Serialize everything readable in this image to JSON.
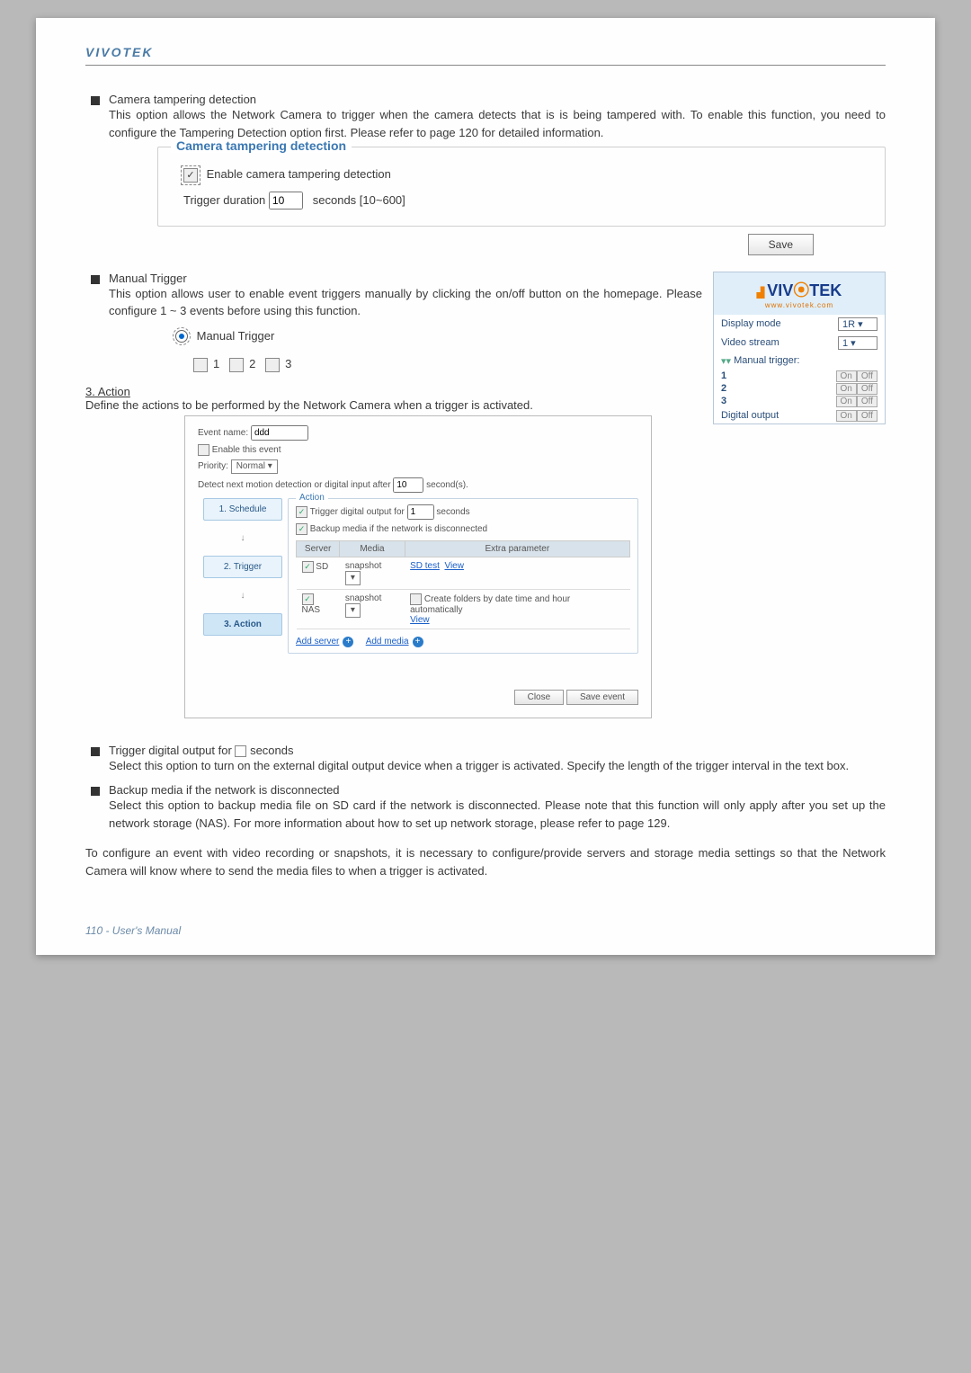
{
  "brand": "VIVOTEK",
  "sections": {
    "tampering": {
      "title": "Camera tampering detection",
      "body": "This option allows the Network Camera to trigger when the camera detects that is is being tampered with. To enable this function, you need to configure the Tampering Detection option first. Please refer to page 120 for detailed information.",
      "legend": "Camera tampering detection",
      "enable_label": "Enable camera tampering detection",
      "trigger_label": "Trigger duration",
      "trigger_value": "10",
      "trigger_units": "seconds [10~600]",
      "save_btn": "Save"
    },
    "manual": {
      "title": "Manual Trigger",
      "body": "This option allows user to enable event triggers manually by clicking the on/off button on the homepage. Please configure 1 ~ 3 events before using this function.",
      "radio_label": "Manual Trigger",
      "check_labels": [
        "1",
        "2",
        "3"
      ]
    },
    "panel": {
      "logo_sub": "www.vivotek.com",
      "display_mode_label": "Display mode",
      "display_mode_value": "1R",
      "video_stream_label": "Video stream",
      "video_stream_value": "1",
      "manual_trigger_label": "Manual trigger:",
      "rows": [
        {
          "n": "1",
          "on": "On",
          "off": "Off"
        },
        {
          "n": "2",
          "on": "On",
          "off": "Off"
        },
        {
          "n": "3",
          "on": "On",
          "off": "Off"
        }
      ],
      "digital_output_label": "Digital output",
      "digital_output_on": "On",
      "digital_output_off": "Off"
    },
    "action": {
      "heading": "3. Action",
      "body": "Define the actions to be performed by the Network Camera when a trigger is activated.",
      "event_name_label": "Event name:",
      "event_name_value": "ddd",
      "enable_event_label": "Enable this event",
      "priority_label": "Priority:",
      "priority_value": "Normal",
      "detect_label_a": "Detect next motion detection or digital input after",
      "detect_value": "10",
      "detect_label_b": "second(s).",
      "steps": [
        "1. Schedule",
        "2. Trigger",
        "3. Action"
      ],
      "legend": "Action",
      "trigger_do_label": "Trigger digital output for",
      "trigger_do_value": "1",
      "trigger_do_units": "seconds",
      "backup_label": "Backup media if the network is disconnected",
      "table": {
        "headers": [
          "Server",
          "Media",
          "Extra parameter"
        ],
        "rows": [
          {
            "srv": "SD",
            "media": "snapshot",
            "extra": [
              "SD test",
              "View"
            ]
          },
          {
            "srv": "NAS",
            "media": "snapshot",
            "extra_note": "Create folders by date time and hour automatically",
            "extra_link": "View"
          }
        ]
      },
      "add_server": "Add server",
      "add_media": "Add media",
      "close_btn": "Close",
      "save_event_btn": "Save event"
    },
    "lower": {
      "do_title": "Trigger digital output for",
      "do_units": "seconds",
      "do_body": "Select this option to turn on the external digital output device when a trigger is activated. Specify the length of the trigger interval in the text box.",
      "bk_title": "Backup media if the network is disconnected",
      "bk_body": "Select this option to backup media file on SD card if the network is disconnected. Please note that this function will only apply after you set up the network storage (NAS). For more information about how to set up network storage, please refer to page 129.",
      "final": "To configure an event with video recording or snapshots, it is necessary to configure/provide servers and storage media settings so that the Network Camera will know where to send the media files to when a trigger is activated."
    }
  },
  "footer": "110 - User's Manual"
}
